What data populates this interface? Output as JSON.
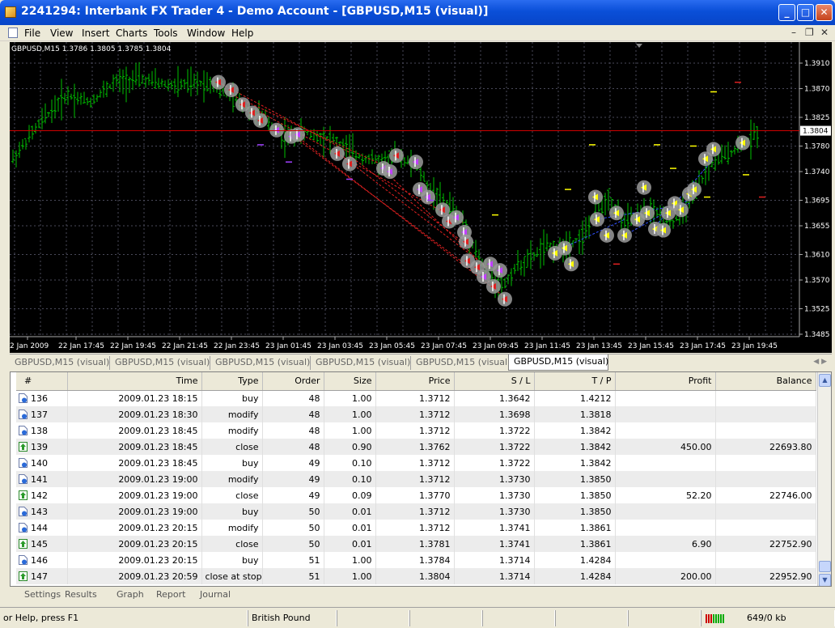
{
  "window": {
    "title": "2241294: Interbank FX Trader 4 - Demo Account - [GBPUSD,M15 (visual)]"
  },
  "menu": [
    "File",
    "View",
    "Insert",
    "Charts",
    "Tools",
    "Window",
    "Help"
  ],
  "chart": {
    "info": "GBPUSD,M15  1.3786 1.3805 1.3785 1.3804",
    "current_price": "1.3804",
    "price_labels": [
      "1.3910",
      "1.3870",
      "1.3825",
      "1.3780",
      "1.3740",
      "1.3695",
      "1.3655",
      "1.3610",
      "1.3570",
      "1.3525",
      "1.3485"
    ],
    "time_labels": [
      "2 Jan 2009",
      "22 Jan 17:45",
      "22 Jan 19:45",
      "22 Jan 21:45",
      "22 Jan 23:45",
      "23 Jan 01:45",
      "23 Jan 03:45",
      "23 Jan 05:45",
      "23 Jan 07:45",
      "23 Jan 09:45",
      "23 Jan 11:45",
      "23 Jan 13:45",
      "23 Jan 15:45",
      "23 Jan 17:45",
      "23 Jan 19:45"
    ],
    "colors": {
      "background": "#000000",
      "bars": "#00c000",
      "grid": "#4a4a5a",
      "price_line": "#d00000",
      "buy_arrow": "#3050ff",
      "sell_arrow": "#e02020",
      "marker": "#ffff00"
    }
  },
  "chart_tabs": [
    {
      "label": "GBPUSD,M15 (visual)",
      "active": false
    },
    {
      "label": "GBPUSD,M15 (visual)",
      "active": false
    },
    {
      "label": "GBPUSD,M15 (visual)",
      "active": false
    },
    {
      "label": "GBPUSD,M15 (visual)",
      "active": false
    },
    {
      "label": "GBPUSD,M15 (visual)",
      "active": false
    },
    {
      "label": "GBPUSD,M15 (visual)",
      "active": true
    }
  ],
  "results": {
    "columns": [
      "#",
      "Time",
      "Type",
      "Order",
      "Size",
      "Price",
      "S / L",
      "T / P",
      "Profit",
      "Balance"
    ],
    "rows": [
      {
        "num": "136",
        "time": "2009.01.23 18:15",
        "type": "buy",
        "order": "48",
        "size": "1.00",
        "price": "1.3712",
        "sl": "1.3642",
        "tp": "1.4212",
        "profit": "",
        "balance": ""
      },
      {
        "num": "137",
        "time": "2009.01.23 18:30",
        "type": "modify",
        "order": "48",
        "size": "1.00",
        "price": "1.3712",
        "sl": "1.3698",
        "tp": "1.3818",
        "profit": "",
        "balance": ""
      },
      {
        "num": "138",
        "time": "2009.01.23 18:45",
        "type": "modify",
        "order": "48",
        "size": "1.00",
        "price": "1.3712",
        "sl": "1.3722",
        "tp": "1.3842",
        "profit": "",
        "balance": ""
      },
      {
        "num": "139",
        "time": "2009.01.23 18:45",
        "type": "close",
        "order": "48",
        "size": "0.90",
        "price": "1.3762",
        "sl": "1.3722",
        "tp": "1.3842",
        "profit": "450.00",
        "balance": "22693.80"
      },
      {
        "num": "140",
        "time": "2009.01.23 18:45",
        "type": "buy",
        "order": "49",
        "size": "0.10",
        "price": "1.3712",
        "sl": "1.3722",
        "tp": "1.3842",
        "profit": "",
        "balance": ""
      },
      {
        "num": "141",
        "time": "2009.01.23 19:00",
        "type": "modify",
        "order": "49",
        "size": "0.10",
        "price": "1.3712",
        "sl": "1.3730",
        "tp": "1.3850",
        "profit": "",
        "balance": ""
      },
      {
        "num": "142",
        "time": "2009.01.23 19:00",
        "type": "close",
        "order": "49",
        "size": "0.09",
        "price": "1.3770",
        "sl": "1.3730",
        "tp": "1.3850",
        "profit": "52.20",
        "balance": "22746.00"
      },
      {
        "num": "143",
        "time": "2009.01.23 19:00",
        "type": "buy",
        "order": "50",
        "size": "0.01",
        "price": "1.3712",
        "sl": "1.3730",
        "tp": "1.3850",
        "profit": "",
        "balance": ""
      },
      {
        "num": "144",
        "time": "2009.01.23 20:15",
        "type": "modify",
        "order": "50",
        "size": "0.01",
        "price": "1.3712",
        "sl": "1.3741",
        "tp": "1.3861",
        "profit": "",
        "balance": ""
      },
      {
        "num": "145",
        "time": "2009.01.23 20:15",
        "type": "close",
        "order": "50",
        "size": "0.01",
        "price": "1.3781",
        "sl": "1.3741",
        "tp": "1.3861",
        "profit": "6.90",
        "balance": "22752.90"
      },
      {
        "num": "146",
        "time": "2009.01.23 20:15",
        "type": "buy",
        "order": "51",
        "size": "1.00",
        "price": "1.3784",
        "sl": "1.3714",
        "tp": "1.4284",
        "profit": "",
        "balance": ""
      },
      {
        "num": "147",
        "time": "2009.01.23 20:59",
        "type": "close at stop",
        "order": "51",
        "size": "1.00",
        "price": "1.3804",
        "sl": "1.3714",
        "tp": "1.4284",
        "profit": "200.00",
        "balance": "22952.90"
      }
    ]
  },
  "bottom_tabs": [
    {
      "label": "Settings",
      "active": false
    },
    {
      "label": "Results",
      "active": true
    },
    {
      "label": "Graph",
      "active": false
    },
    {
      "label": "Report",
      "active": false
    },
    {
      "label": "Journal",
      "active": false
    }
  ],
  "status": {
    "help": "or Help, press F1",
    "profile": "British Pound",
    "traffic": "649/0 kb"
  }
}
